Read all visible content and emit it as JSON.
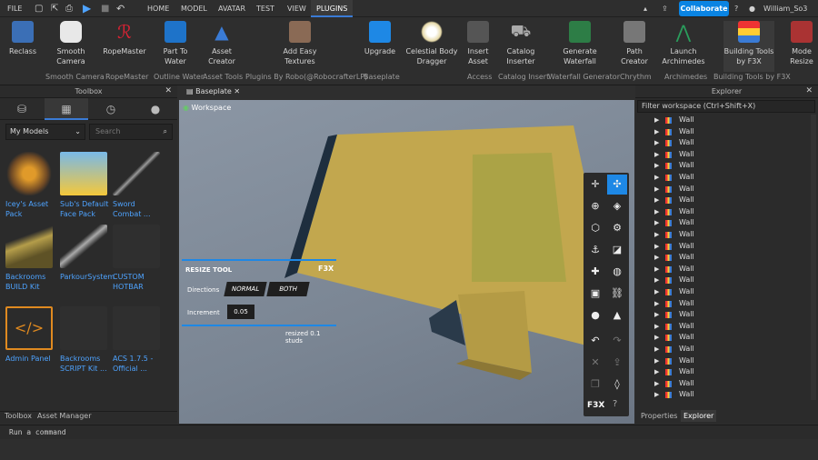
{
  "menu": {
    "file": "FILE",
    "home": "HOME",
    "model": "MODEL",
    "avatar": "AVATAR",
    "test": "TEST",
    "view": "VIEW",
    "plugins": "PLUGINS",
    "collaborate": "Collaborate",
    "username": "William_So3"
  },
  "ribbon": {
    "buttons": [
      {
        "label": "Reclass",
        "icon": "reclass-icon"
      },
      {
        "label": "Smooth Camera",
        "icon": "camera-icon"
      },
      {
        "label": "RopeMaster",
        "icon": "rope-icon"
      },
      {
        "label": "Part To Water",
        "icon": "water-icon"
      },
      {
        "label": "Asset Creator",
        "icon": "wizard-hat-icon"
      },
      {
        "label": "Add Easy Textures",
        "icon": "texture-icon"
      },
      {
        "label": "Upgrade",
        "icon": "upgrade-icon"
      },
      {
        "label": "Celestial Body Dragger",
        "icon": "moon-icon"
      },
      {
        "label": "Insert Asset",
        "icon": "insert-icon"
      },
      {
        "label": "Catalog Inserter",
        "icon": "cart-icon"
      },
      {
        "label": "Generate Waterfall",
        "icon": "waterfall-icon"
      },
      {
        "label": "Path Creator",
        "icon": "path-icon"
      },
      {
        "label": "Launch Archimedes",
        "icon": "archimedes-icon"
      },
      {
        "label": "Building Tools by F3X",
        "icon": "f3x-icon"
      },
      {
        "label": "Mode Resize",
        "icon": "mode-icon"
      }
    ],
    "groups": [
      "Smooth Camera",
      "RopeMaster",
      "Outline Water",
      "Asset Tools",
      "Plugins By Robo(@RobocrafterLP)",
      "Baseplate",
      "Access",
      "Catalog Insert",
      "Waterfall Generator",
      "Chrythm",
      "Archimedes",
      "Building Tools by F3X"
    ]
  },
  "toolbox": {
    "title": "Toolbox",
    "category": "My Models",
    "search_placeholder": "Search",
    "assets": [
      {
        "name": "Icey's Asset Pack"
      },
      {
        "name": "Sub's Default Face Pack"
      },
      {
        "name": "Sword Combat ..."
      },
      {
        "name": "Backrooms BUILD Kit"
      },
      {
        "name": "ParkourSystem"
      },
      {
        "name": "CUSTOM HOTBAR"
      },
      {
        "name": "Admin Panel"
      },
      {
        "name": "Backrooms SCRIPT Kit ..."
      },
      {
        "name": "ACS 1.7.5 - Official ..."
      }
    ],
    "bottom_tabs": [
      "Toolbox",
      "Asset Manager"
    ]
  },
  "viewport": {
    "tab": "Baseplate",
    "workspace": "Workspace"
  },
  "resize_tool": {
    "title": "RESIZE TOOL",
    "brand": "F3X",
    "directions_label": "Directions",
    "normal": "NORMAL",
    "both": "BOTH",
    "increment_label": "Increment",
    "increment_value": "0.05",
    "status": "resized 0.1 studs"
  },
  "explorer": {
    "title": "Explorer",
    "filter_placeholder": "Filter workspace (Ctrl+Shift+X)",
    "item_label": "Wall",
    "bottom_tabs": [
      "Properties",
      "Explorer"
    ]
  },
  "command": {
    "placeholder": "Run a command"
  },
  "colors": {
    "accent": "#3a7bd5",
    "collab": "#0a84e3",
    "link": "#4ea3ff"
  }
}
